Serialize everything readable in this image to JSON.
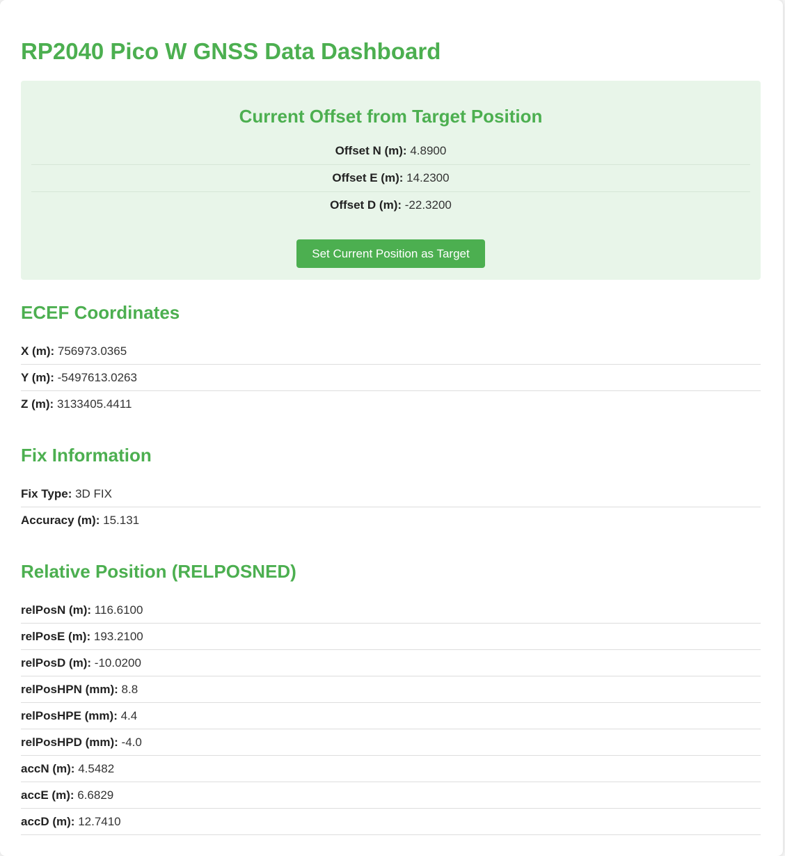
{
  "page_title": "RP2040 Pico W GNSS Data Dashboard",
  "offset": {
    "heading": "Current Offset from Target Position",
    "rows": [
      {
        "label": "Offset N (m):",
        "value": "4.8900"
      },
      {
        "label": "Offset E (m):",
        "value": "14.2300"
      },
      {
        "label": "Offset D (m):",
        "value": "-22.3200"
      }
    ],
    "button_label": "Set Current Position as Target"
  },
  "ecef": {
    "heading": "ECEF Coordinates",
    "rows": [
      {
        "label": "X (m):",
        "value": "756973.0365"
      },
      {
        "label": "Y (m):",
        "value": "-5497613.0263"
      },
      {
        "label": "Z (m):",
        "value": "3133405.4411"
      }
    ]
  },
  "fix": {
    "heading": "Fix Information",
    "rows": [
      {
        "label": "Fix Type:",
        "value": "3D FIX"
      },
      {
        "label": "Accuracy (m):",
        "value": "15.131"
      }
    ]
  },
  "relposned": {
    "heading": "Relative Position (RELPOSNED)",
    "rows": [
      {
        "label": "relPosN (m):",
        "value": "116.6100"
      },
      {
        "label": "relPosE (m):",
        "value": "193.2100"
      },
      {
        "label": "relPosD (m):",
        "value": "-10.0200"
      },
      {
        "label": "relPosHPN (mm):",
        "value": "8.8"
      },
      {
        "label": "relPosHPE (mm):",
        "value": "4.4"
      },
      {
        "label": "relPosHPD (mm):",
        "value": "-4.0"
      },
      {
        "label": "accN (m):",
        "value": "4.5482"
      },
      {
        "label": "accE (m):",
        "value": "6.6829"
      },
      {
        "label": "accD (m):",
        "value": "12.7410"
      }
    ]
  },
  "colors": {
    "accent": "#4caf50",
    "panel_bg": "#e8f5e9"
  }
}
